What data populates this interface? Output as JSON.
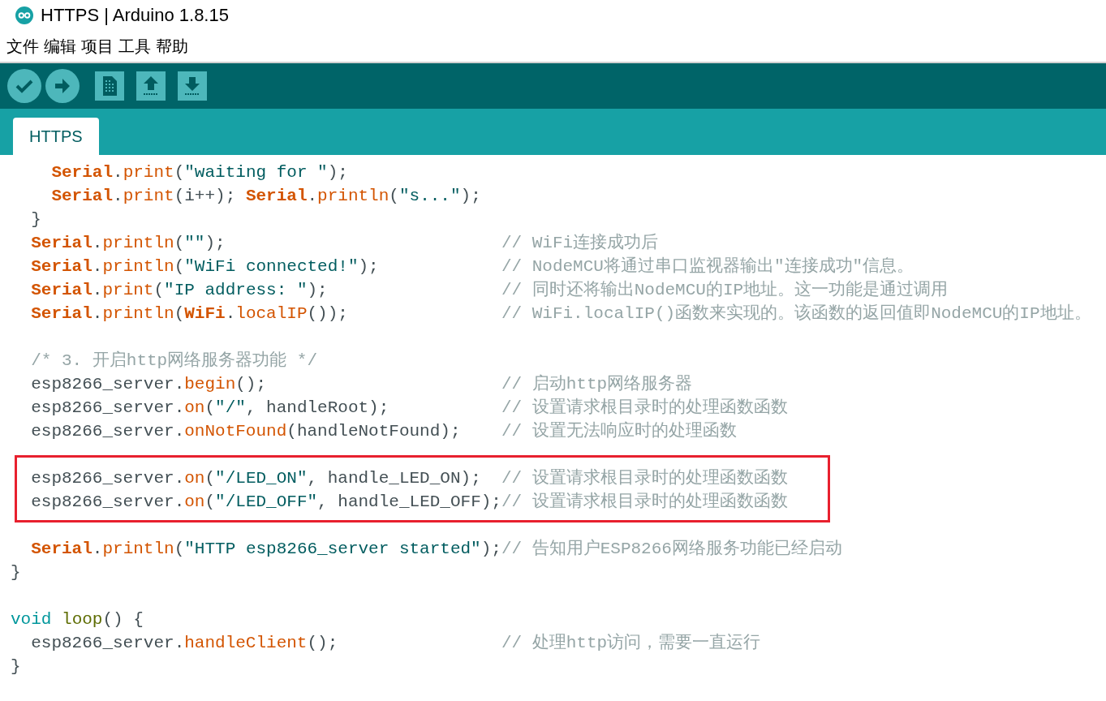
{
  "window": {
    "title": "HTTPS | Arduino 1.8.15"
  },
  "menu": [
    "文件",
    "编辑",
    "项目",
    "工具",
    "帮助"
  ],
  "tabs": [
    {
      "label": "HTTPS",
      "selected": true
    }
  ],
  "code": {
    "lines": [
      {
        "kind": "code",
        "highlighted": false,
        "tokens": [
          {
            "kind": "keyword",
            "text": "    Serial"
          },
          {
            "kind": "plain",
            "text": "."
          },
          {
            "kind": "function",
            "text": "print"
          },
          {
            "kind": "plain",
            "text": "("
          },
          {
            "kind": "string",
            "text": "\"waiting for \""
          },
          {
            "kind": "plain",
            "text": ");"
          }
        ]
      },
      {
        "kind": "code",
        "highlighted": false,
        "tokens": [
          {
            "kind": "keyword",
            "text": "    Serial"
          },
          {
            "kind": "plain",
            "text": "."
          },
          {
            "kind": "function",
            "text": "print"
          },
          {
            "kind": "plain",
            "text": "(i++); "
          },
          {
            "kind": "keyword",
            "text": "Serial"
          },
          {
            "kind": "plain",
            "text": "."
          },
          {
            "kind": "function",
            "text": "println"
          },
          {
            "kind": "plain",
            "text": "("
          },
          {
            "kind": "string",
            "text": "\"s...\""
          },
          {
            "kind": "plain",
            "text": ");"
          }
        ]
      },
      {
        "kind": "code",
        "highlighted": false,
        "tokens": [
          {
            "kind": "plain",
            "text": "  }"
          }
        ]
      },
      {
        "kind": "code",
        "highlighted": false,
        "tokens": [
          {
            "kind": "keyword",
            "text": "  Serial"
          },
          {
            "kind": "plain",
            "text": "."
          },
          {
            "kind": "function",
            "text": "println"
          },
          {
            "kind": "plain",
            "text": "("
          },
          {
            "kind": "string",
            "text": "\"\""
          },
          {
            "kind": "plain",
            "text": ");"
          }
        ],
        "comment": "// WiFi连接成功后"
      },
      {
        "kind": "code",
        "highlighted": false,
        "tokens": [
          {
            "kind": "keyword",
            "text": "  Serial"
          },
          {
            "kind": "plain",
            "text": "."
          },
          {
            "kind": "function",
            "text": "println"
          },
          {
            "kind": "plain",
            "text": "("
          },
          {
            "kind": "string",
            "text": "\"WiFi connected!\""
          },
          {
            "kind": "plain",
            "text": ");"
          }
        ],
        "comment": "// NodeMCU将通过串口监视器输出\"连接成功\"信息。"
      },
      {
        "kind": "code",
        "highlighted": false,
        "tokens": [
          {
            "kind": "keyword",
            "text": "  Serial"
          },
          {
            "kind": "plain",
            "text": "."
          },
          {
            "kind": "function",
            "text": "print"
          },
          {
            "kind": "plain",
            "text": "("
          },
          {
            "kind": "string",
            "text": "\"IP address: \""
          },
          {
            "kind": "plain",
            "text": ");"
          }
        ],
        "comment": "// 同时还将输出NodeMCU的IP地址。这一功能是通过调用"
      },
      {
        "kind": "code",
        "highlighted": false,
        "tokens": [
          {
            "kind": "keyword",
            "text": "  Serial"
          },
          {
            "kind": "plain",
            "text": "."
          },
          {
            "kind": "function",
            "text": "println"
          },
          {
            "kind": "plain",
            "text": "("
          },
          {
            "kind": "keyword",
            "text": "WiFi"
          },
          {
            "kind": "plain",
            "text": "."
          },
          {
            "kind": "function",
            "text": "localIP"
          },
          {
            "kind": "plain",
            "text": "());"
          }
        ],
        "comment": "// WiFi.localIP()函数来实现的。该函数的返回值即NodeMCU的IP地址。"
      },
      {
        "kind": "blank",
        "highlighted": false
      },
      {
        "kind": "code",
        "highlighted": false,
        "tokens": [
          {
            "kind": "comment",
            "text": "  /* 3. 开启http网络服务器功能 */"
          }
        ]
      },
      {
        "kind": "code",
        "highlighted": false,
        "tokens": [
          {
            "kind": "plain",
            "text": "  esp8266_server."
          },
          {
            "kind": "function",
            "text": "begin"
          },
          {
            "kind": "plain",
            "text": "();"
          }
        ],
        "comment": "// 启动http网络服务器"
      },
      {
        "kind": "code",
        "highlighted": false,
        "tokens": [
          {
            "kind": "plain",
            "text": "  esp8266_server."
          },
          {
            "kind": "function",
            "text": "on"
          },
          {
            "kind": "plain",
            "text": "("
          },
          {
            "kind": "string",
            "text": "\"/\""
          },
          {
            "kind": "plain",
            "text": ", handleRoot);"
          }
        ],
        "comment": "// 设置请求根目录时的处理函数函数"
      },
      {
        "kind": "code",
        "highlighted": false,
        "tokens": [
          {
            "kind": "plain",
            "text": "  esp8266_server."
          },
          {
            "kind": "function",
            "text": "onNotFound"
          },
          {
            "kind": "plain",
            "text": "(handleNotFound);"
          }
        ],
        "comment": "// 设置无法响应时的处理函数"
      },
      {
        "kind": "blank",
        "highlighted": false
      },
      {
        "kind": "code",
        "highlighted": true,
        "tokens": [
          {
            "kind": "plain",
            "text": "  esp8266_server."
          },
          {
            "kind": "function",
            "text": "on"
          },
          {
            "kind": "plain",
            "text": "("
          },
          {
            "kind": "string",
            "text": "\"/LED_ON\""
          },
          {
            "kind": "plain",
            "text": ", handle_LED_ON);"
          }
        ],
        "comment": "// 设置请求根目录时的处理函数函数"
      },
      {
        "kind": "code",
        "highlighted": true,
        "tokens": [
          {
            "kind": "plain",
            "text": "  esp8266_server."
          },
          {
            "kind": "function",
            "text": "on"
          },
          {
            "kind": "plain",
            "text": "("
          },
          {
            "kind": "string",
            "text": "\"/LED_OFF\""
          },
          {
            "kind": "plain",
            "text": ", handle_LED_OFF);"
          }
        ],
        "comment": "// 设置请求根目录时的处理函数函数"
      },
      {
        "kind": "blank",
        "highlighted": false
      },
      {
        "kind": "code",
        "highlighted": false,
        "tokens": [
          {
            "kind": "keyword",
            "text": "  Serial"
          },
          {
            "kind": "plain",
            "text": "."
          },
          {
            "kind": "function",
            "text": "println"
          },
          {
            "kind": "plain",
            "text": "("
          },
          {
            "kind": "string",
            "text": "\"HTTP esp8266_server started\""
          },
          {
            "kind": "plain",
            "text": ");"
          }
        ],
        "comment": "// 告知用户ESP8266网络服务功能已经启动"
      },
      {
        "kind": "code",
        "highlighted": false,
        "tokens": [
          {
            "kind": "plain",
            "text": "}"
          }
        ]
      },
      {
        "kind": "blank",
        "highlighted": false
      },
      {
        "kind": "code",
        "highlighted": false,
        "tokens": [
          {
            "kind": "type",
            "text": "void"
          },
          {
            "kind": "name",
            "text": " loop"
          },
          {
            "kind": "plain",
            "text": "() {"
          }
        ]
      },
      {
        "kind": "code",
        "highlighted": false,
        "tokens": [
          {
            "kind": "plain",
            "text": "  esp8266_server."
          },
          {
            "kind": "function",
            "text": "handleClient"
          },
          {
            "kind": "plain",
            "text": "();"
          }
        ],
        "comment": "// 处理http访问，需要一直运行"
      },
      {
        "kind": "code",
        "highlighted": false,
        "tokens": [
          {
            "kind": "plain",
            "text": "}"
          }
        ]
      }
    ]
  }
}
